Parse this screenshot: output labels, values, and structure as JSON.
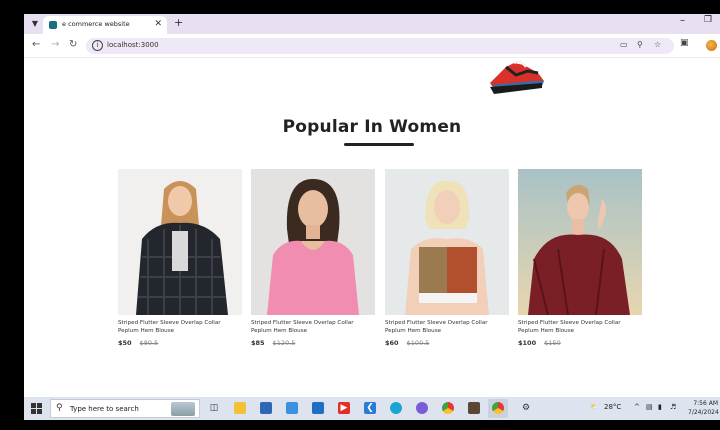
{
  "browser": {
    "tab_title": "e commerce website",
    "url": "localhost:3000"
  },
  "icons": {
    "tab_dropdown": "chevron-down-icon",
    "back": "arrow-left-icon",
    "forward": "arrow-right-icon",
    "reload": "reload-icon",
    "info": "info-icon",
    "new_tab": "plus-icon",
    "close_tab": "close-icon"
  },
  "section": {
    "title": "Popular In Women"
  },
  "products": [
    {
      "name": "Striped Flutter Sleeve Overlap Collar Peplum Hem Blouse",
      "price_new": "$50",
      "price_old": "$80.5"
    },
    {
      "name": "Striped Flutter Sleeve Overlap Collar Peplum Hem Blouse",
      "price_new": "$85",
      "price_old": "$120.5"
    },
    {
      "name": "Striped Flutter Sleeve Overlap Collar Peplum Hem Blouse",
      "price_new": "$60",
      "price_old": "$100.5"
    },
    {
      "name": "Striped Flutter Sleeve Overlap Collar Peplum Hem Blouse",
      "price_new": "$100",
      "price_old": "$150"
    }
  ],
  "taskbar": {
    "search_placeholder": "Type here to search",
    "temperature": "28°C",
    "time": "7:56 AM",
    "date": "7/24/2024"
  },
  "colors": {
    "tabstrip": "#e9dff3",
    "taskbar": "#dde4ef",
    "text": "#222222"
  }
}
